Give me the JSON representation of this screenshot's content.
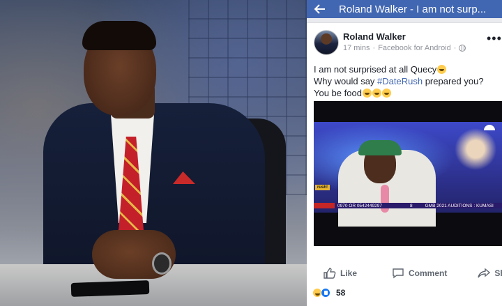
{
  "topbar": {
    "title": "Roland Walker - I am not surp..."
  },
  "post": {
    "author": "Roland Walker",
    "time": "17 mins",
    "source": "Facebook for Android",
    "separator": "·",
    "more": "•••",
    "line1": "I am not surprised at all Quecy",
    "line2_pre": "Why would say ",
    "hashtag": "#DateRush",
    "line2_post": " prepared you?",
    "line3": "You be food"
  },
  "media": {
    "tag": "rush!",
    "ticker_phone": "0970 OR 0542449297",
    "ticker_mid": "8",
    "ticker_auditions": "GMB 2021 AUDITIONS : KUMASI"
  },
  "actions": {
    "like": "Like",
    "comment": "Comment",
    "share": "Share"
  },
  "reactions": {
    "count": "58"
  },
  "colors": {
    "fb_blue": "#4267b2",
    "hashtag": "#4267b2",
    "action_text": "#606770"
  }
}
